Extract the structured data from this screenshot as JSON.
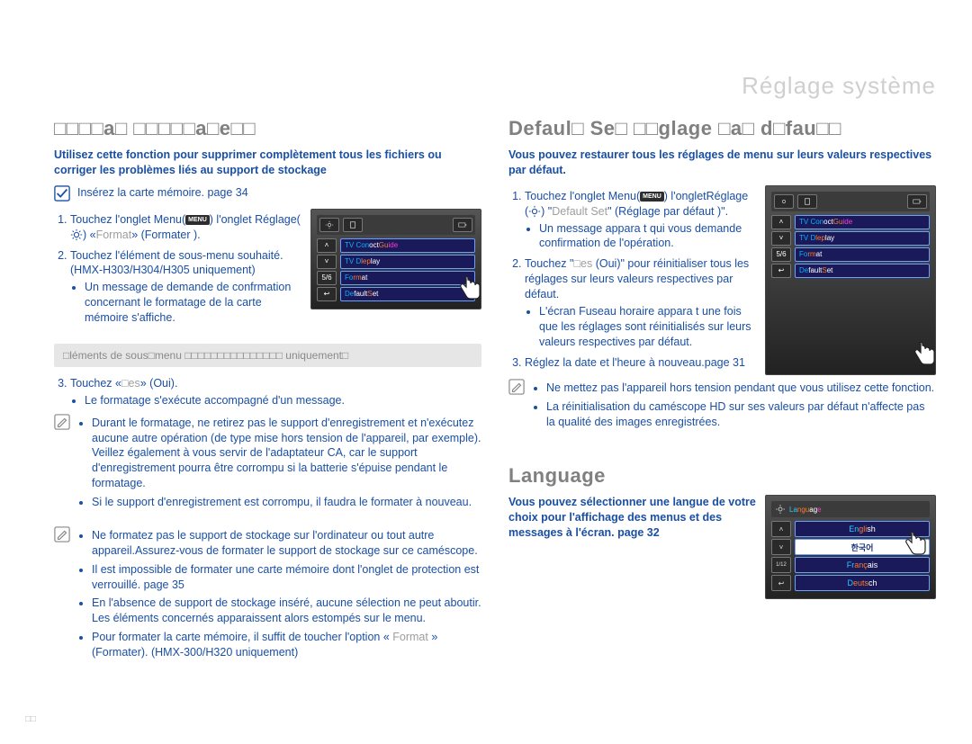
{
  "header": {
    "section": "Réglage système"
  },
  "left": {
    "heading": "□□□□a□ □□□□□a□e□□",
    "intro": "Utilisez cette fonction pour supprimer complètement tous les fichiers ou corriger les problèmes liés au support de stockage",
    "insert_note": "Insérez la carte mémoire.  page 34",
    "step1_a": "Touchez l'onglet Menu(",
    "step1_b": ")  l'onglet Réglage(",
    "step1_c": ")  «",
    "step1_format_gray": "Format",
    "step1_d": "» (Formater ).",
    "step2_a": "Touchez l'élément de sous-menu souhaité.",
    "step2_b": "(HMX-H303/H304/H305 uniquement)",
    "step2_bullet": "Un message de demande de confrmation concernant le formatage de la carte mémoire s'affiche.",
    "subheader": "□léments de sous□menu □□□□□□□□□□□□□□□ uniquement□",
    "step3_a": "Touchez «",
    "step3_yes_gray": "□es",
    "step3_b": "» (Oui).",
    "step3_bullet": "Le formatage s'exécute accompagné d'un message.",
    "warn1_li1": "Durant le formatage, ne retirez pas le support d'enregistrement et n'exécutez aucune autre opération (de type mise hors tension de l'appareil, par exemple). Veillez également à vous servir de l'adaptateur CA, car le support d'enregistrement pourra être corrompu si la batterie s'épuise pendant le formatage.",
    "warn1_li2": "Si le support d'enregistrement est corrompu, il faudra le formater à nouveau.",
    "warn2_li1": "Ne formatez pas le support de stockage sur l'ordinateur ou tout autre appareil.Assurez-vous de formater le support de stockage sur ce caméscope.",
    "warn2_li2": "Il est impossible de formater une carte mémoire dont l'onglet de protection est verrouillé.  page 35",
    "warn2_li3": "En l'absence de support de stockage inséré, aucune sélection ne peut aboutir. Les éléments concernés apparaissent alors estompés sur le menu.",
    "warn2_li4_a": "Pour formater la carte mémoire, il suffit de toucher l'option « ",
    "warn2_li4_gray": "Format",
    "warn2_li4_b": " » (Formater). (HMX-300/H320 uniquement)",
    "panel": {
      "page": "5/6",
      "row1_a": "TV Con",
      "row1_b": "oct ",
      "row1_c": "Gu",
      "row1_d": "ide",
      "row2_a": "TV D",
      "row2_b": "lep",
      "row2_c": "lay",
      "row3_a": "Fo",
      "row3_b": "rm",
      "row3_c": "at",
      "row4_a": "De",
      "row4_b": "fault ",
      "row4_c": "S",
      "row4_d": "et"
    }
  },
  "rightTop": {
    "heading": "Defaul□ Se□ □□glage □a□ d□fau□□",
    "intro": "Vous pouvez restaurer tous les réglages de menu sur leurs valeurs respectives par défaut.",
    "step1_a": "Touchez l'onglet Menu(",
    "step1_b": ")  l'ongletRéglage (",
    "step1_c": ")  \"",
    "step1_gray": "Default Set",
    "step1_d": "\" (Réglage par défaut )\".",
    "step1_bullet": "Un message appara t qui vous demande confirmation de l'opération.",
    "step2_a": "Touchez \"",
    "step2_gray": "□es",
    "step2_b": " (Oui)\" pour réinitialiser tous les réglages sur leurs valeurs respectives par défaut.",
    "step2_bullet": "L'écran Fuseau horaire appara t une fois que les réglages sont réinitialisés sur leurs valeurs respectives par défaut.",
    "step3": "Réglez la date et l'heure à nouveau.page 31",
    "warn_li1": "Ne mettez pas l'appareil hors tension pendant que vous utilisez cette fonction.",
    "warn_li2": "La réinitialisation du caméscope HD sur ses valeurs par défaut n'affecte pas la qualité des images enregistrées.",
    "panel": {
      "page": "5/6",
      "row1_a": "TV Con",
      "row1_b": "oct ",
      "row1_c": "Gu",
      "row1_d": "ide",
      "row2_a": "TV D",
      "row2_b": "lep",
      "row2_c": "lay",
      "row3_a": "Fo",
      "row3_b": "rm",
      "row3_c": "at",
      "row4_a": "De",
      "row4_b": "fault ",
      "row4_c": "S",
      "row4_d": "et"
    }
  },
  "rightBottom": {
    "heading": "Language",
    "intro": "Vous pouvez sélectionner une langue de votre choix pour l'affichage des menus et des messages à l'écran.  page 32",
    "panel": {
      "title_a": "La",
      "title_b": "ngu",
      "title_c": "ag",
      "title_d": "e",
      "row1_a": "En",
      "row1_b": "gli",
      "row1_c": "sh",
      "row2": "한국어",
      "row3_a": "Fr",
      "row3_b": "anç",
      "row3_c": "ais",
      "row4_a": "D",
      "row4_b": "euts",
      "row4_c": "ch",
      "side": "1/12"
    }
  },
  "pageNumber": "□□",
  "labels": {
    "menu": "MENU"
  }
}
